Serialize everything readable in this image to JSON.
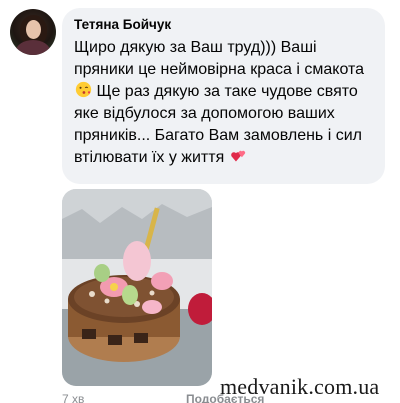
{
  "comment": {
    "author": "Тетяна Бойчук",
    "text_part1": "Щиро дякую за Ваш труд))) Ваші пряники це неймовірна краса і смакота",
    "text_part2": " Ще раз дякую за таке чудове свято яке відбулося за допомогою ваших пряників... Багато Вам замовлень і сил втілювати їх у життя ",
    "emoji_1": "kiss-face-icon",
    "emoji_2": "two-hearts-icon"
  },
  "meta": {
    "time": "7 хв",
    "reply": "Подобається"
  },
  "watermark": "medvanik.com.ua",
  "colors": {
    "bubble": "#f0f2f5",
    "text": "#050505",
    "meta": "#8a8d91"
  }
}
